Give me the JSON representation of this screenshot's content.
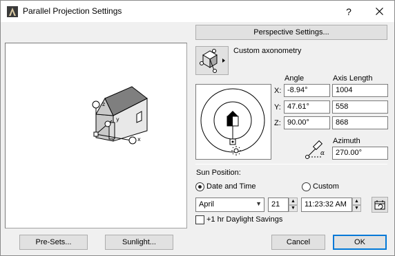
{
  "window": {
    "title": "Parallel Projection Settings",
    "help_label": "?",
    "close_label": "✕"
  },
  "perspective_button": "Perspective Settings...",
  "projection_mode": "Custom axonometry",
  "camera": {
    "angle_header": "Angle",
    "length_header": "Axis Length",
    "x_label": "X:",
    "y_label": "Y:",
    "z_label": "Z:",
    "x_angle": "-8.94°",
    "y_angle": "47.61°",
    "z_angle": "90.00°",
    "x_length": "1004",
    "y_length": "558",
    "z_length": "868",
    "azimuth_label": "Azimuth",
    "azimuth": "270.00°"
  },
  "preview_axis": {
    "z": "z",
    "y": "y",
    "x": "x"
  },
  "sun": {
    "title": "Sun Position:",
    "date_time_label": "Date and Time",
    "custom_label": "Custom",
    "month": "April",
    "day": "21",
    "time": "11:23:32 AM",
    "daylight_label": "+1 hr Daylight Savings",
    "alpha": "α"
  },
  "footer": {
    "presets": "Pre-Sets...",
    "sunlight": "Sunlight...",
    "cancel": "Cancel",
    "ok": "OK"
  }
}
